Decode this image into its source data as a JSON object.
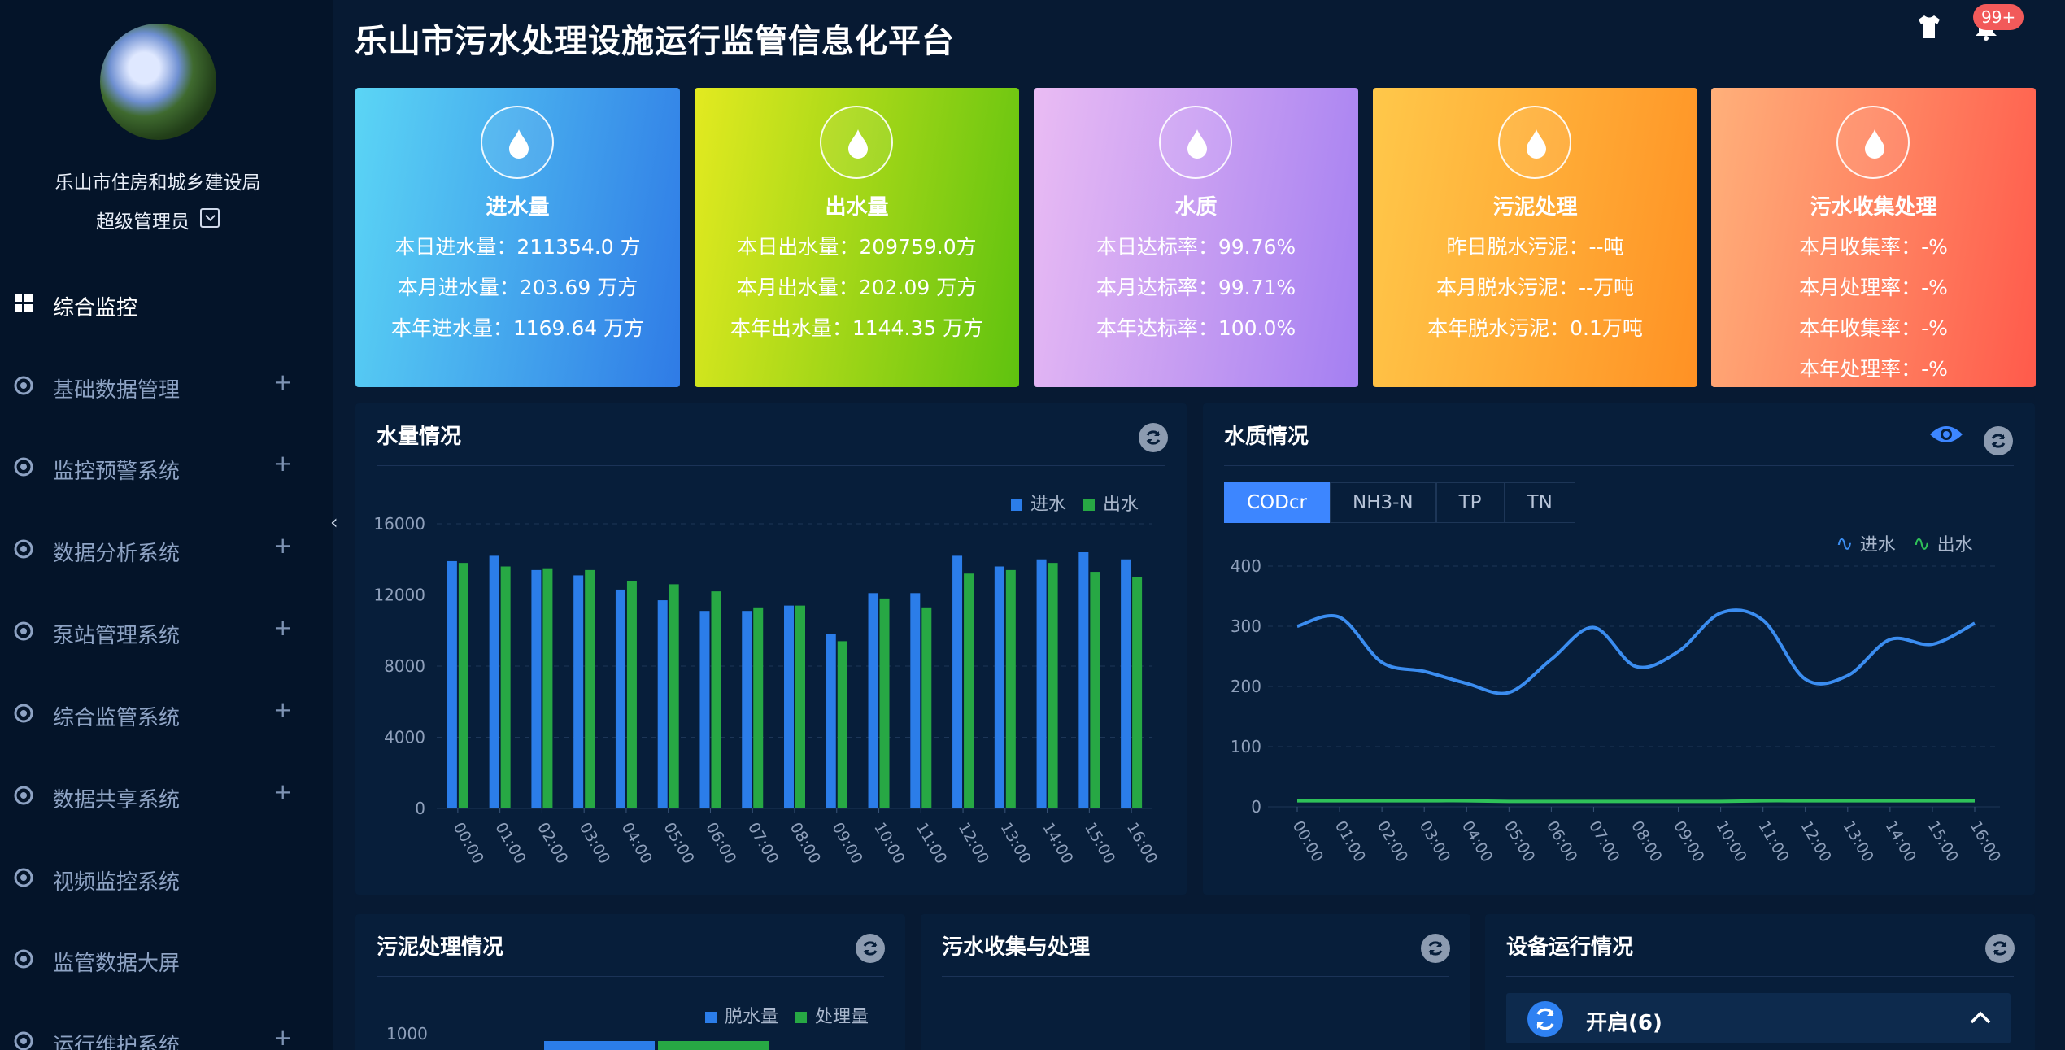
{
  "header": {
    "title": "乐山市污水处理设施运行监管信息化平台",
    "badge": "99+"
  },
  "sidebar": {
    "org": "乐山市住房和城乡建设局",
    "role": "超级管理员",
    "items": [
      {
        "label": "综合监控",
        "icon": "dashboard-icon",
        "active": true,
        "expandable": false
      },
      {
        "label": "基础数据管理",
        "icon": "image-icon",
        "active": false,
        "expandable": true
      },
      {
        "label": "监控预警系统",
        "icon": "flame-icon",
        "active": false,
        "expandable": true
      },
      {
        "label": "数据分析系统",
        "icon": "pie-icon",
        "active": false,
        "expandable": true
      },
      {
        "label": "泵站管理系统",
        "icon": "pump-icon",
        "active": false,
        "expandable": true
      },
      {
        "label": "综合监管系统",
        "icon": "layers-icon",
        "active": false,
        "expandable": true
      },
      {
        "label": "数据共享系统",
        "icon": "share-icon",
        "active": false,
        "expandable": true
      },
      {
        "label": "视频监控系统",
        "icon": "camera-icon",
        "active": false,
        "expandable": false
      },
      {
        "label": "监管数据大屏",
        "icon": "screen-icon",
        "active": false,
        "expandable": false
      },
      {
        "label": "运行维护系统",
        "icon": "gear-icon",
        "active": false,
        "expandable": true
      }
    ]
  },
  "cards": [
    {
      "title": "进水量",
      "icon": "water-drop-icon",
      "gradient": [
        "#5bd5f5",
        "#2f7be6"
      ],
      "lines": [
        "本日进水量：211354.0 方",
        "本月进水量：203.69 万方",
        "本年进水量：1169.64 万方"
      ]
    },
    {
      "title": "出水量",
      "icon": "faucet-icon",
      "gradient": [
        "#e3ea20",
        "#5fc20f"
      ],
      "lines": [
        "本日出水量：209759.0方",
        "本月出水量：202.09 万方",
        "本年出水量：1144.35 万方"
      ]
    },
    {
      "title": "水质",
      "icon": "water-cup-icon",
      "gradient": [
        "#eabcf3",
        "#a47ff2"
      ],
      "lines": [
        "本日达标率：99.76%",
        "本月达标率：99.71%",
        "本年达标率：100.0%"
      ]
    },
    {
      "title": "污泥处理",
      "icon": "sludge-icon",
      "gradient": [
        "#ffc84a",
        "#ff9124"
      ],
      "lines": [
        "昨日脱水污泥：--吨",
        "本月脱水污泥：--万吨",
        "本年脱水污泥：0.1万吨"
      ]
    },
    {
      "title": "污水收集处理",
      "icon": "sewage-pipe-icon",
      "gradient": [
        "#ffb07a",
        "#ff5a4b"
      ],
      "lines": [
        "本月收集率：-%",
        "本月处理率：-%",
        "本年收集率：-%",
        "本年处理率：-%"
      ]
    }
  ],
  "panels": {
    "water_volume": {
      "title": "水量情况",
      "legend": [
        "进水",
        "出水"
      ]
    },
    "water_quality": {
      "title": "水质情况",
      "tabs": [
        "CODcr",
        "NH3-N",
        "TP",
        "TN"
      ],
      "active_tab": "CODcr",
      "legend": [
        "进水",
        "出水"
      ]
    },
    "sludge": {
      "title": "污泥处理情况",
      "legend": [
        "脱水量",
        "处理量"
      ],
      "y_top_label": "1000"
    },
    "sewage": {
      "title": "污水收集与处理"
    },
    "equipment": {
      "title": "设备运行情况",
      "accordion_label": "开启(6)"
    }
  },
  "colors": {
    "series_in": "#2b7de9",
    "series_out": "#27a844",
    "line_in": "#3b8df0",
    "line_out": "#2fc159"
  },
  "chart_data": [
    {
      "type": "bar",
      "title": "水量情况",
      "categories": [
        "00:00",
        "01:00",
        "02:00",
        "03:00",
        "04:00",
        "05:00",
        "06:00",
        "07:00",
        "08:00",
        "09:00",
        "10:00",
        "11:00",
        "12:00",
        "13:00",
        "14:00",
        "15:00",
        "16:00"
      ],
      "series": [
        {
          "name": "进水",
          "values": [
            13900,
            14200,
            13400,
            13100,
            12300,
            11700,
            11100,
            11100,
            11400,
            9800,
            12100,
            12100,
            14200,
            13600,
            14000,
            14400,
            14000
          ]
        },
        {
          "name": "出水",
          "values": [
            13800,
            13600,
            13500,
            13400,
            12800,
            12600,
            12200,
            11300,
            11400,
            9400,
            11800,
            11300,
            13200,
            13400,
            13800,
            13300,
            13000
          ]
        }
      ],
      "yticks": [
        0,
        4000,
        8000,
        12000,
        16000
      ],
      "ylim": [
        0,
        16000
      ]
    },
    {
      "type": "line",
      "title": "水质情况",
      "categories": [
        "00:00",
        "01:00",
        "02:00",
        "03:00",
        "04:00",
        "05:00",
        "06:00",
        "07:00",
        "08:00",
        "09:00",
        "10:00",
        "11:00",
        "12:00",
        "13:00",
        "14:00",
        "15:00",
        "16:00"
      ],
      "series": [
        {
          "name": "进水",
          "values": [
            300,
            315,
            240,
            225,
            205,
            190,
            245,
            298,
            233,
            258,
            322,
            310,
            212,
            218,
            278,
            270,
            305
          ]
        },
        {
          "name": "出水",
          "values": [
            10,
            10,
            10,
            10,
            10,
            9,
            9,
            9,
            9,
            9,
            9,
            10,
            10,
            10,
            10,
            10,
            10
          ]
        }
      ],
      "yticks": [
        0,
        100,
        200,
        300,
        400
      ],
      "ylim": [
        0,
        400
      ]
    }
  ]
}
